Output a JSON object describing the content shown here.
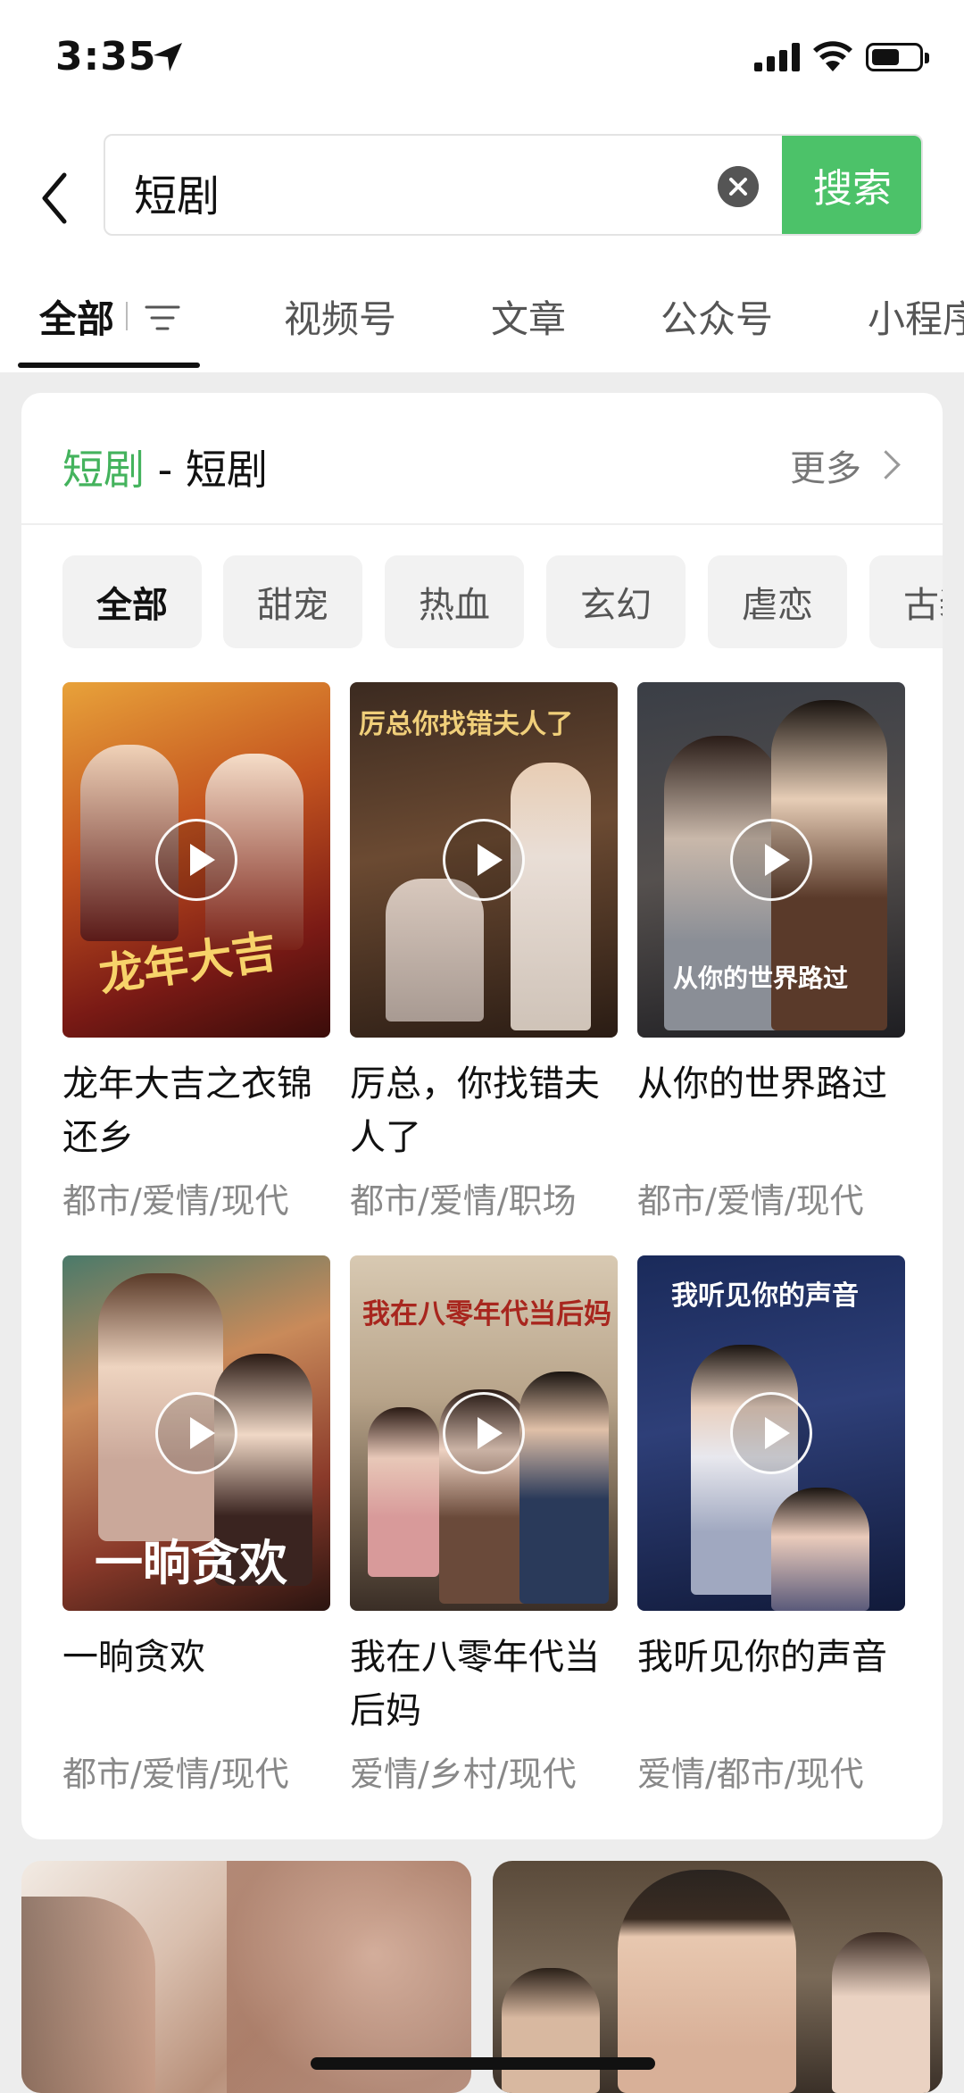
{
  "status_bar": {
    "time": "3:35"
  },
  "search": {
    "query": "短剧",
    "button_label": "搜索"
  },
  "tabs": [
    "全部",
    "视频号",
    "文章",
    "公众号",
    "小程序"
  ],
  "card": {
    "title_highlight": "短剧",
    "title_rest": " - 短剧",
    "more_label": "更多",
    "chips": [
      "全部",
      "甜宠",
      "热血",
      "玄幻",
      "虐恋",
      "古装"
    ],
    "items": [
      {
        "title": "龙年大吉之衣锦还乡",
        "tags": "都市/爱情/现代",
        "poster_text": "龙年大吉"
      },
      {
        "title": "厉总，你找错夫人了",
        "tags": "都市/爱情/职场",
        "poster_text": "厉总你找错夫人了"
      },
      {
        "title": "从你的世界路过",
        "tags": "都市/爱情/现代",
        "poster_text": "从你的世界路过"
      },
      {
        "title": "一晌贪欢",
        "tags": "都市/爱情/现代",
        "poster_text": "一晌贪欢"
      },
      {
        "title": "我在八零年代当后妈",
        "tags": "爱情/乡村/现代",
        "poster_text": "我在八零年代当后妈"
      },
      {
        "title": "我听见你的声音",
        "tags": "爱情/都市/现代",
        "poster_text": "我听见你的声音"
      }
    ]
  },
  "colors": {
    "accent_green": "#4cc269",
    "title_green": "#44b35d"
  }
}
